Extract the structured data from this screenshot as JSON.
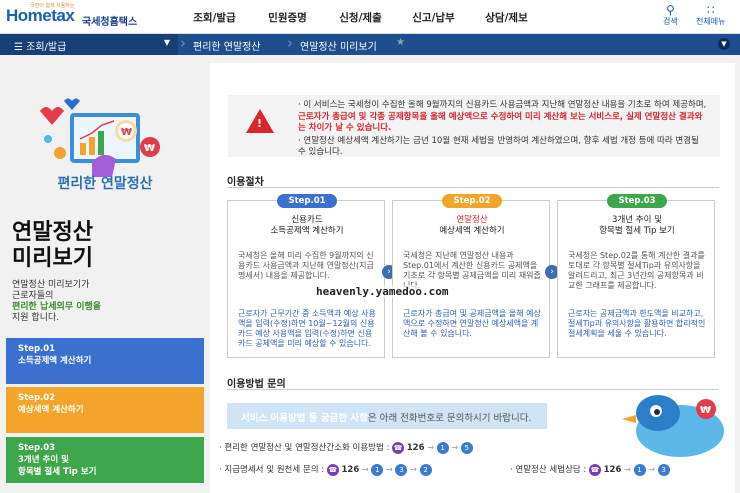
{
  "header": {
    "logo": "Hometax",
    "logo_tagline": "국민이 쉽게 사용하는",
    "logo_sub": "국세청홈택스",
    "menu": [
      "조회/발급",
      "민원증명",
      "신청/제출",
      "신고/납부",
      "상담/제보"
    ],
    "search_label": "검색",
    "allmenu_label": "전체메뉴"
  },
  "nav": {
    "current": "조회/발급",
    "crumb1": "편리한 연말정산",
    "crumb2": "연말정산 미리보기"
  },
  "left": {
    "illus_title": "편리한 연말정산",
    "big_title_1": "연말정산",
    "big_title_2": "미리보기",
    "desc_1": "연말정산 미리보기가",
    "desc_2": "근로자들의",
    "desc_3": "편리한 납세의무 이행을",
    "desc_4": "지원 합니다.",
    "buttons": [
      {
        "step": "Step.01",
        "label": "소득공제액 계산하기",
        "color": "#3b6fd0"
      },
      {
        "step": "Step.02",
        "label": "예상세액 계산하기",
        "color": "#f2a52a"
      },
      {
        "step": "Step.03",
        "label": "3개년 추이 및",
        "label2": "항목별 절세 Tip 보기",
        "color": "#3fa74b"
      }
    ]
  },
  "notice": {
    "p1_a": "· 이 서비스는 국세청이 수집한 올해 9월까지의 신용카드 사용금액과 지난해 연말정산 내용을 기초로 하여 제공하며,",
    "p1_b": "근로자가 총급여 및 각종 공제항목을 올해 예상액으로 수정하여 미리 계산해 보는 서비스로, 실제 연말정산 결과와는 차이가 날 수 있습니다.",
    "p2": "· 연말정산 예상세액 계산하기는 금년 10월 현재 세법을 반영하여 계산하였으며, 향후 세법 개정 등에 따라 변경될 수 있습니다."
  },
  "procedure": {
    "title": "이용절차",
    "cards": [
      {
        "step": "Step.01",
        "color": "#3b6fd0",
        "title1": "신용카드",
        "title2": "소득공제액 계산하기",
        "body": "국세청은 올해 미리 수집한 9월까지의 신용카드 사용금액과 지난해 연말정산(지급명세서) 내용을 제공합니다.",
        "highlight": "근로자가 근무기간 중 소득액과 예상 사용액을 입력(수정)하면 10월~12월의 신용카드 예상 사용액을 입력(수정)하면 신용카드 공제액을 미리 예상할 수 있습니다."
      },
      {
        "step": "Step.02",
        "color": "#f2a52a",
        "title1": "연말정산",
        "title2": "예상세액 계산하기",
        "body": "국세청은 지난해 연말정산 내용과 Step.01에서 계산한 신용카드 공제액을 기초로 각 항목별 공제금액을 미리 채워줍니다.",
        "highlight": "근로자가 총급여 및 공제금액을 올해 예상액으로 수정하면 연말정산 예상세액을 계산해 볼 수 있습니다."
      },
      {
        "step": "Step.03",
        "color": "#3fa74b",
        "title1": "3개년 추이 및",
        "title2": "항목별 절세 Tip 보기",
        "body": "국세청은 Step.02를 통해 계산한 결과를 토대로 각 항목별 절세Tip과 유의사항을 알려드리고, 최근 3년간의 공제항목과 비교한 그래프를 제공합니다.",
        "highlight": "근로자는 공제금액과 한도액을 비교하고, 절세Tip과 유의사항을 활용하면 합리적인 절세계획을 세울 수 있습니다."
      }
    ]
  },
  "inquiry": {
    "title": "이용방법 문의",
    "banner_bold": "서비스 이용방법 등 궁금한 사항",
    "banner_rest": "은 아래 전화번호로 문의하시기 바랍니다.",
    "line1": "· 편리한 연말정산 및 연말정산간소화 이용방법 :",
    "line1_code": "126",
    "line1_nums": [
      "1",
      "5"
    ],
    "line2": "· 지급명세서 및 원천세 문의 :",
    "line2_code": "126",
    "line2_nums": [
      "1",
      "3",
      "2"
    ],
    "line3": "· 연말정산 세법상담 :",
    "line3_code": "126",
    "line3_nums": [
      "1",
      "3"
    ]
  },
  "watermark": "heavenly.yamedoo.com"
}
